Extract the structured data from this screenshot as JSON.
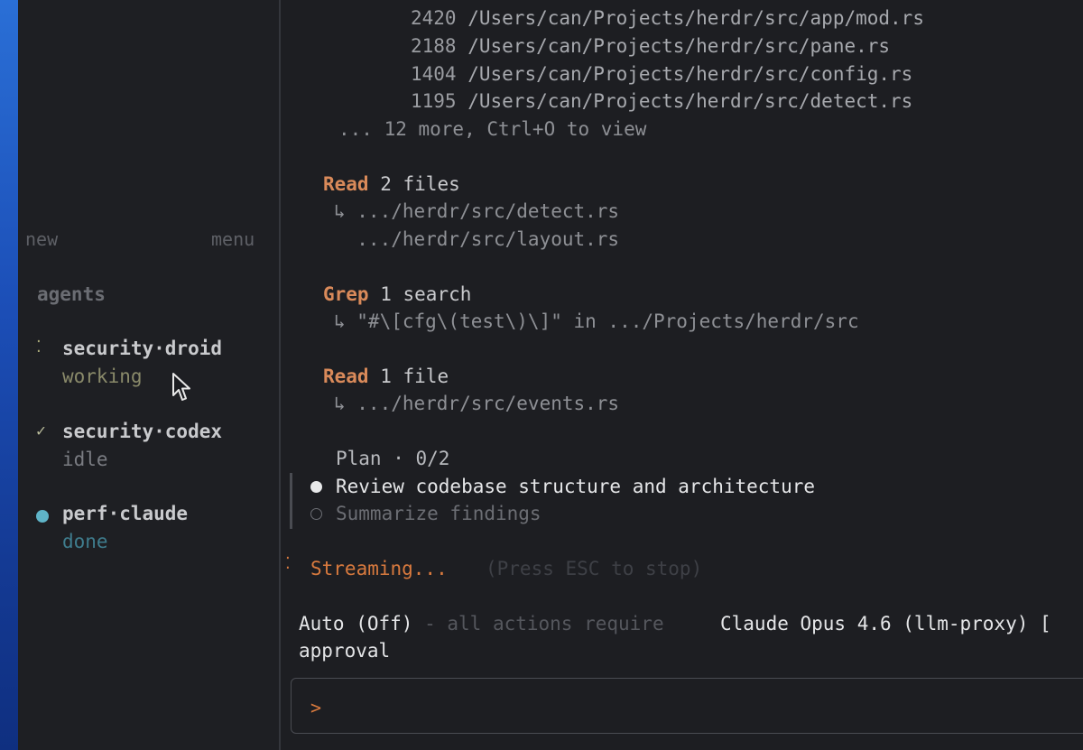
{
  "sidebar": {
    "new_label": "new",
    "menu_label": "menu",
    "section_title": "agents",
    "agents": [
      {
        "mark": "⁚",
        "name": "security·droid",
        "status": "working",
        "status_color": "#8a8a6a"
      },
      {
        "mark": "✓",
        "name": "security·codex",
        "status": "idle",
        "status_color": "#7a7c82"
      },
      {
        "mark": "",
        "name": "perf·claude",
        "status": "done",
        "status_color": "#3f7d8e"
      }
    ]
  },
  "main": {
    "files": [
      {
        "count": "2420",
        "path": "/Users/can/Projects/herdr/src/app/mod.rs"
      },
      {
        "count": "2188",
        "path": "/Users/can/Projects/herdr/src/pane.rs"
      },
      {
        "count": "1404",
        "path": "/Users/can/Projects/herdr/src/config.rs"
      },
      {
        "count": "1195",
        "path": "/Users/can/Projects/herdr/src/detect.rs"
      }
    ],
    "more_text": "... 12 more, Ctrl+O to view",
    "tool_calls": [
      {
        "tool": "Read",
        "desc": "2 files",
        "lines": [
          "↳ .../herdr/src/detect.rs",
          "  .../herdr/src/layout.rs"
        ]
      },
      {
        "tool": "Grep",
        "desc": "1 search",
        "lines": [
          "↳ \"#\\[cfg\\(test\\)\\]\" in .../Projects/herdr/src"
        ]
      },
      {
        "tool": "Read",
        "desc": "1 file",
        "lines": [
          "↳ .../herdr/src/events.rs"
        ]
      }
    ],
    "plan": {
      "title": "Plan · 0/2",
      "items": [
        "Review codebase structure and architecture",
        "Summarize findings"
      ]
    },
    "streaming": {
      "icon": "⁚",
      "label": "Streaming...",
      "hint": "(Press ESC to stop)"
    },
    "status_bar": {
      "mode": "Auto (Off)",
      "mode_desc_1": " - all actions require",
      "mode_desc_2": "approval",
      "model": "Claude Opus 4.6 (llm-proxy) [",
      "model_tail": "("
    },
    "input": {
      "prompt": ">"
    }
  }
}
